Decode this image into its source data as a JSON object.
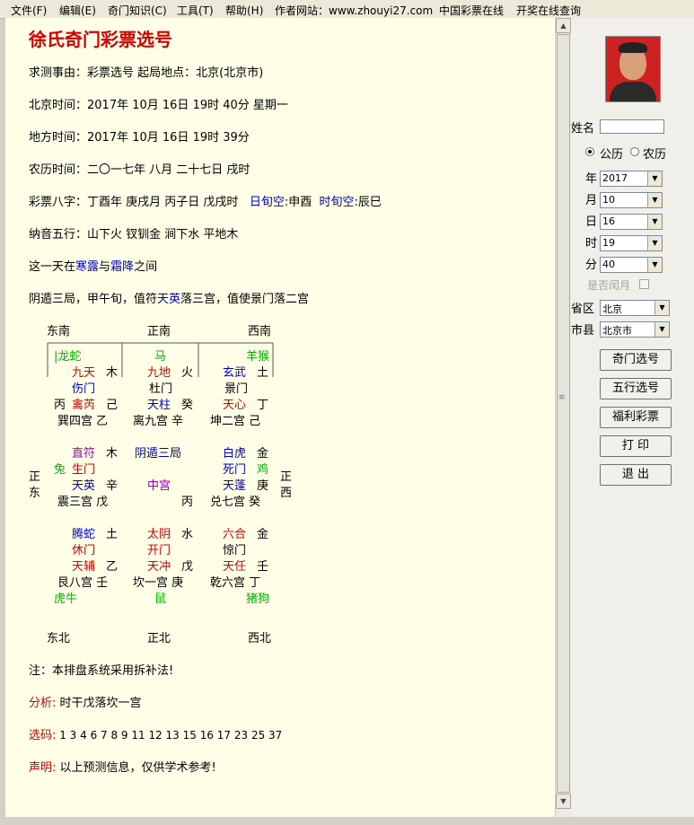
{
  "menu": [
    "文件(F)",
    "编辑(E)",
    "奇门知识(C)",
    "工具(T)",
    "帮助(H)",
    "作者网站：www.zhouyi27.com",
    "中国彩票在线",
    "开奖在线查询"
  ],
  "content": {
    "title": "徐氏奇门彩票选号",
    "shice": "求测事由：彩票选号  起局地点：北京(北京市)",
    "beijing_time": "北京时间：2017年  10月  16日  19时  40分  星期一",
    "local_time": "地方时间：2017年  10月  16日  19时  39分",
    "lunar_time": "农历时间：二〇一七年  八月  二十七日  戌时",
    "bazi_prefix": "彩票八字：丁酉年  庚戌月  丙子日  戊戌时",
    "ri_xunkong_label": "日旬空",
    "ri_xunkong_value": ":申酉",
    "shi_xunkong_label": "时旬空",
    "shi_xunkong_value": ":辰巳",
    "nayin": "纳音五行：山下火  钗钏金  涧下水  平地木",
    "jieqi_pre": "这一天在",
    "jieqi_a": "寒露",
    "jieqi_mid": "与",
    "jieqi_b": "霜降",
    "jieqi_post": "之间",
    "ju_pre": "阴遁三局，甲午旬，值符",
    "ju_star": "天英",
    "ju_post": "落三宫，值使景门落二宫",
    "note": "注：本排盘系统采用拆补法!",
    "analysis_label": "分析:",
    "analysis_value": "时干戊落坎一宫",
    "numbers_label": "选码:",
    "numbers_value": "1  3  4  6  7  8  9  11  12  13  15  16  17  23  25  37",
    "statement_label": "声明:",
    "statement_value": "以上预测信息，仅供学术参考!"
  },
  "chart": {
    "top": [
      "东南",
      "正南",
      "西南"
    ],
    "bottom": [
      "东北",
      "正北",
      "西北"
    ],
    "left": [
      "正",
      "东"
    ],
    "right": [
      "正",
      "西"
    ],
    "cells": [
      {
        "t": "|龙蛇",
        "c": "green"
      },
      {
        "t": "马",
        "c": "green"
      },
      {
        "t": "羊猴",
        "c": "green"
      },
      {
        "t": "九天",
        "c": "red"
      },
      {
        "t": "木",
        "c": "black"
      },
      {
        "t": "九地",
        "c": "red"
      },
      {
        "t": "火",
        "c": "black"
      },
      {
        "t": "玄武",
        "c": "blue"
      },
      {
        "t": "土",
        "c": "black"
      },
      {
        "t": "伤门",
        "c": "blue"
      },
      {
        "t": "杜门",
        "c": "black"
      },
      {
        "t": "景门",
        "c": "black"
      },
      {
        "t": "丙",
        "c": "black"
      },
      {
        "t": "禽芮",
        "c": "red"
      },
      {
        "t": "己",
        "c": "black"
      },
      {
        "t": "天柱",
        "c": "blue"
      },
      {
        "t": "癸",
        "c": "black"
      },
      {
        "t": "天心",
        "c": "red"
      },
      {
        "t": "丁",
        "c": "black"
      },
      {
        "t": "巽四宫  乙",
        "c": "black"
      },
      {
        "t": "离九宫  辛",
        "c": "black"
      },
      {
        "t": "坤二宫  己",
        "c": "black"
      },
      {
        "t": "直符",
        "c": "purple"
      },
      {
        "t": "木",
        "c": "black"
      },
      {
        "t": "阴遁三局",
        "c": "blue"
      },
      {
        "t": "白虎",
        "c": "blue"
      },
      {
        "t": "金",
        "c": "black"
      },
      {
        "t": "兔",
        "c": "green"
      },
      {
        "t": "生门",
        "c": "red"
      },
      {
        "t": "死门",
        "c": "blue"
      },
      {
        "t": "鸡",
        "c": "green"
      },
      {
        "t": "天英",
        "c": "blue"
      },
      {
        "t": "辛",
        "c": "black"
      },
      {
        "t": "中宫",
        "c": "purple"
      },
      {
        "t": "天蓬",
        "c": "blue"
      },
      {
        "t": "庚",
        "c": "black"
      },
      {
        "t": "震三宫  戊",
        "c": "black"
      },
      {
        "t": "丙",
        "c": "black"
      },
      {
        "t": "兑七宫  癸",
        "c": "black"
      },
      {
        "t": "腾蛇",
        "c": "blue"
      },
      {
        "t": "土",
        "c": "black"
      },
      {
        "t": "太阴",
        "c": "red"
      },
      {
        "t": "水",
        "c": "black"
      },
      {
        "t": "六合",
        "c": "red"
      },
      {
        "t": "金",
        "c": "black"
      },
      {
        "t": "休门",
        "c": "red"
      },
      {
        "t": "开门",
        "c": "red"
      },
      {
        "t": "惊门",
        "c": "black"
      },
      {
        "t": "天辅",
        "c": "red"
      },
      {
        "t": "乙",
        "c": "black"
      },
      {
        "t": "天冲",
        "c": "red"
      },
      {
        "t": "戊",
        "c": "black"
      },
      {
        "t": "天任",
        "c": "red"
      },
      {
        "t": "壬",
        "c": "black"
      },
      {
        "t": "艮八宫  壬",
        "c": "black"
      },
      {
        "t": "坎一宫  庚",
        "c": "black"
      },
      {
        "t": "乾六宫  丁",
        "c": "black"
      },
      {
        "t": "虎牛",
        "c": "green"
      },
      {
        "t": "鼠",
        "c": "green"
      },
      {
        "t": "猪狗",
        "c": "green"
      }
    ]
  },
  "side": {
    "name_label": "姓名",
    "name_value": "",
    "radio_solar": "公历",
    "radio_lunar": "农历",
    "year_label": "年",
    "year_value": "2017",
    "month_label": "月",
    "month_value": "10",
    "day_label": "日",
    "day_value": "16",
    "hour_label": "时",
    "hour_value": "19",
    "minute_label": "分",
    "minute_value": "40",
    "leap_label": "是否闰月",
    "province_label": "省区",
    "province_value": "北京",
    "city_label": "市县",
    "city_value": "北京市",
    "buttons": [
      "奇门选号",
      "五行选号",
      "福利彩票",
      "打 印",
      "退 出"
    ]
  }
}
